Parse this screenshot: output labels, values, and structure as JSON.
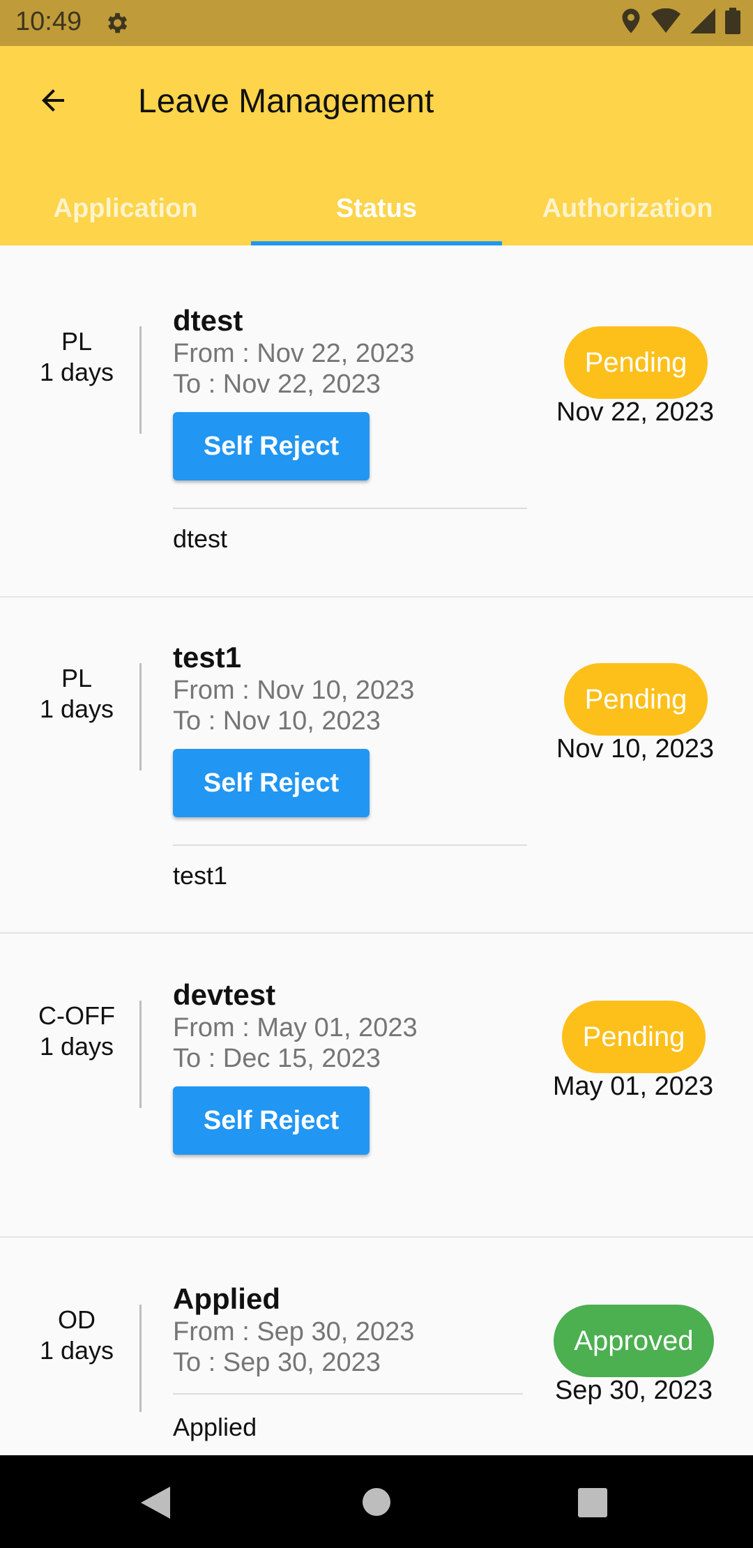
{
  "status_bar": {
    "time": "10:49",
    "icons": [
      "settings-gear",
      "location-pin",
      "wifi",
      "signal",
      "battery"
    ]
  },
  "app_bar": {
    "title": "Leave Management",
    "back_icon": "arrow-back"
  },
  "tabs": [
    {
      "label": "Application",
      "active": false
    },
    {
      "label": "Status",
      "active": true
    },
    {
      "label": "Authorization",
      "active": false
    }
  ],
  "colors": {
    "app_bar": "#fdd44a",
    "tab_indicator": "#2196f3",
    "pending": "#fdbf1a",
    "approved": "#4caf50",
    "button": "#2196f3"
  },
  "leaves": [
    {
      "type": "PL",
      "days": "1 days",
      "title": "dtest",
      "from": "From : Nov 22, 2023",
      "to": "To : Nov 22, 2023",
      "button": "Self Reject",
      "remark": "dtest",
      "status": "Pending",
      "date": "Nov 22, 2023"
    },
    {
      "type": "PL",
      "days": "1 days",
      "title": "test1",
      "from": "From : Nov 10, 2023",
      "to": "To : Nov 10, 2023",
      "button": "Self Reject",
      "remark": "test1",
      "status": "Pending",
      "date": "Nov 10, 2023"
    },
    {
      "type": "C-OFF",
      "days": "1 days",
      "title": "devtest",
      "from": "From : May 01, 2023",
      "to": "To : Dec 15, 2023",
      "button": "Self Reject",
      "remark": "",
      "status": "Pending",
      "date": "May 01, 2023"
    },
    {
      "type": "OD",
      "days": "1 days",
      "title": "Applied",
      "from": "From : Sep 30, 2023",
      "to": "To : Sep 30, 2023",
      "button": "",
      "remark": "Applied",
      "status": "Approved",
      "date": "Sep 30, 2023"
    }
  ],
  "nav_bar": {
    "icons": [
      "back-triangle",
      "home-circle",
      "recents-square"
    ]
  }
}
